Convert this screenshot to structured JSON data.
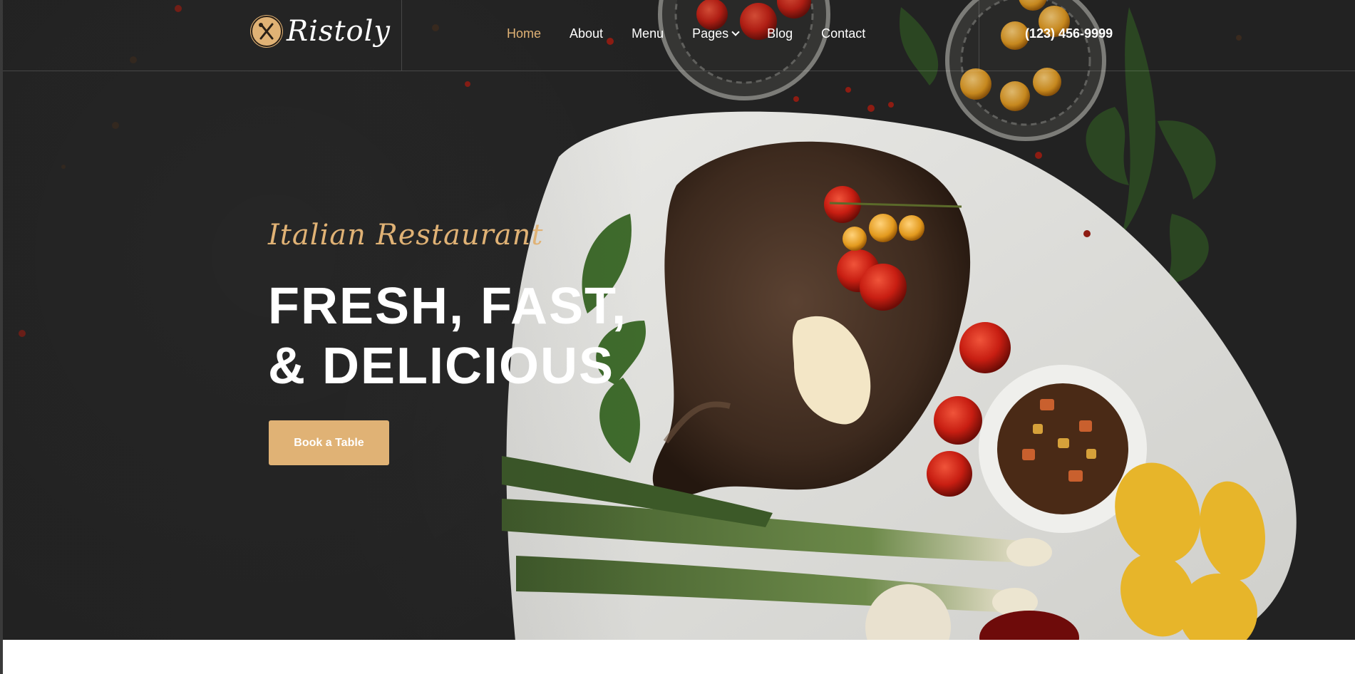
{
  "brand": {
    "name": "Ristoly",
    "accent_color": "#e0b275",
    "logo_icon": "fork-knife-icon"
  },
  "nav": {
    "items": [
      {
        "label": "Home",
        "active": true
      },
      {
        "label": "About"
      },
      {
        "label": "Menu"
      },
      {
        "label": "Pages",
        "has_dropdown": true
      },
      {
        "label": "Blog"
      },
      {
        "label": "Contact"
      }
    ]
  },
  "header": {
    "phone": "(123) 456-9999"
  },
  "hero": {
    "subtitle": "Italian Restaurant",
    "headline_line1": "FRESH, FAST,",
    "headline_line2": "& DELICIOUS",
    "cta_label": "Book a Table",
    "background_color": "#222222",
    "image_subject": "grilled steak platter with cherry tomatoes, grilled corn, green onions and salsa"
  }
}
